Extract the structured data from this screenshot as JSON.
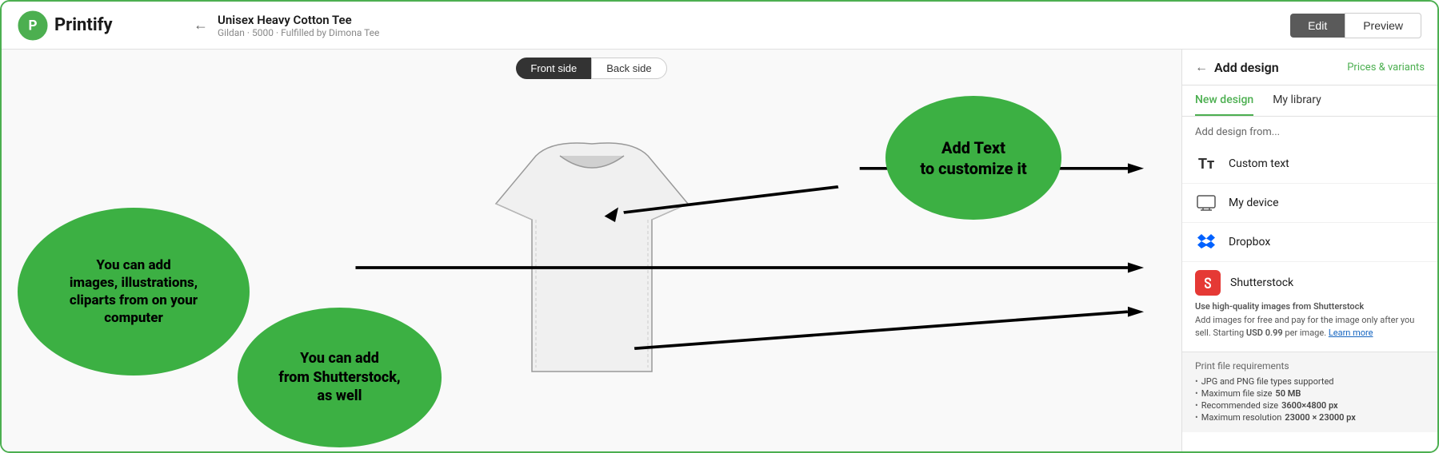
{
  "app": {
    "logo_text": "Printify"
  },
  "header": {
    "back_arrow": "←",
    "product_title": "Unisex Heavy Cotton Tee",
    "product_subtitle": "Gildan · 5000 · Fulfilled by Dimona Tee",
    "btn_edit": "Edit",
    "btn_preview": "Preview"
  },
  "canvas": {
    "tab_front": "Front side",
    "tab_back": "Back side"
  },
  "bubbles": {
    "top_right": "Add Text\nto customize it",
    "left": "You can add\nimages, illustrations,\ncliparts from on your\ncomputer",
    "bottom_center": "You can add\nfrom Shutterstock,\nas well"
  },
  "right_panel": {
    "back_arrow": "←",
    "title": "Add design",
    "prices_link": "Prices & variants",
    "tab_new": "New design",
    "tab_library": "My library",
    "add_design_label": "Add design from...",
    "options": [
      {
        "icon": "Tт",
        "label": "Custom text",
        "icon_name": "custom-text-icon"
      },
      {
        "icon": "🖥",
        "label": "My device",
        "icon_name": "my-device-icon"
      },
      {
        "icon": "📦",
        "label": "Dropbox",
        "icon_name": "dropbox-icon"
      }
    ],
    "shutterstock": {
      "title": "Shutterstock",
      "logo_char": "S",
      "desc_bold": "Use high-quality images from Shutterstock",
      "desc": "Add images for free and pay for the image only after you sell. Starting",
      "price": "USD 0.99",
      "desc2": "per image.",
      "learn_more": "Learn more"
    },
    "print_requirements": {
      "title": "Print file requirements",
      "items": [
        "JPG and PNG file types supported",
        "Maximum file size 50 MB",
        "Recommended size 3600×4800 px",
        "Maximum resolution 23000 × 23000 px"
      ]
    }
  }
}
